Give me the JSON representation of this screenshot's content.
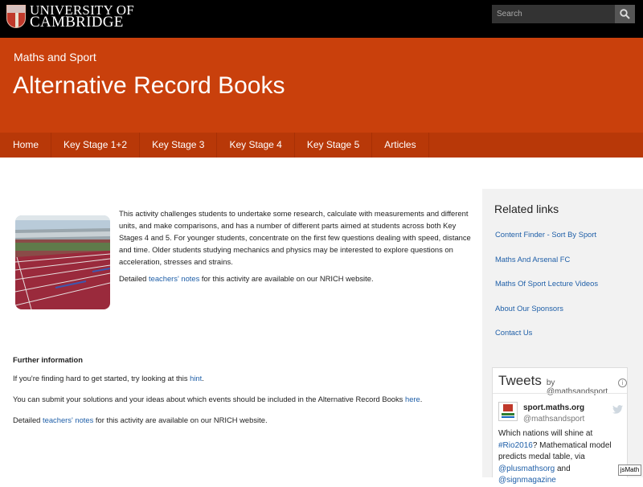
{
  "brand": {
    "line1": "UNIVERSITY OF",
    "line2": "CAMBRIDGE"
  },
  "search": {
    "placeholder": "Search"
  },
  "header": {
    "section": "Maths and Sport",
    "title": "Alternative Record Books"
  },
  "nav": [
    "Home",
    "Key Stage 1+2",
    "Key Stage 3",
    "Key Stage 4",
    "Key Stage 5",
    "Articles"
  ],
  "intro": {
    "p1": "This activity challenges students to undertake some research, calculate with measurements and different units, and make comparisons, and has a number of different parts aimed at students across both Key Stages 4 and 5. For younger students, concentrate on the first few questions dealing with speed, distance and time. Older students studying mechanics and physics may be interested to explore questions on acceleration, stresses and strains.",
    "p2_before": "Detailed ",
    "p2_link": "teachers' notes",
    "p2_after": " for this activity are available on our NRICH website."
  },
  "further": {
    "heading": "Further information",
    "l1_before": "If you're finding hard to get started, try looking at this ",
    "l1_link": "hint",
    "l1_after": ".",
    "l2_before": "You can submit your solutions and your ideas about which events should be included in the Alternative Record Books ",
    "l2_link": "here",
    "l2_after": ".",
    "l3_before": "Detailed ",
    "l3_link": "teachers' notes",
    "l3_after": " for this activity are available on our NRICH website."
  },
  "related": {
    "title": "Related links",
    "links": [
      "Content Finder - Sort By Sport",
      "Maths And Arsenal FC",
      "Maths Of Sport Lecture Videos",
      "About Our Sponsors",
      "Contact Us"
    ]
  },
  "tweets": {
    "title": "Tweets",
    "by": "by",
    "by_handle": "@mathsandsport",
    "name": "sport.maths.org",
    "handle": "@mathsandsport",
    "t1": "Which nations will shine at ",
    "hashtag": "#Rio2016",
    "t2": "? Mathematical model predicts medal table, via ",
    "mention1": "@plusmathsorg",
    "t3": " and ",
    "mention2": "@signmagazine"
  },
  "jsmath": "jsMath",
  "colors": {
    "header_orange": "#c9400c",
    "nav_orange": "#b83808",
    "link_blue": "#1f5fa8"
  }
}
